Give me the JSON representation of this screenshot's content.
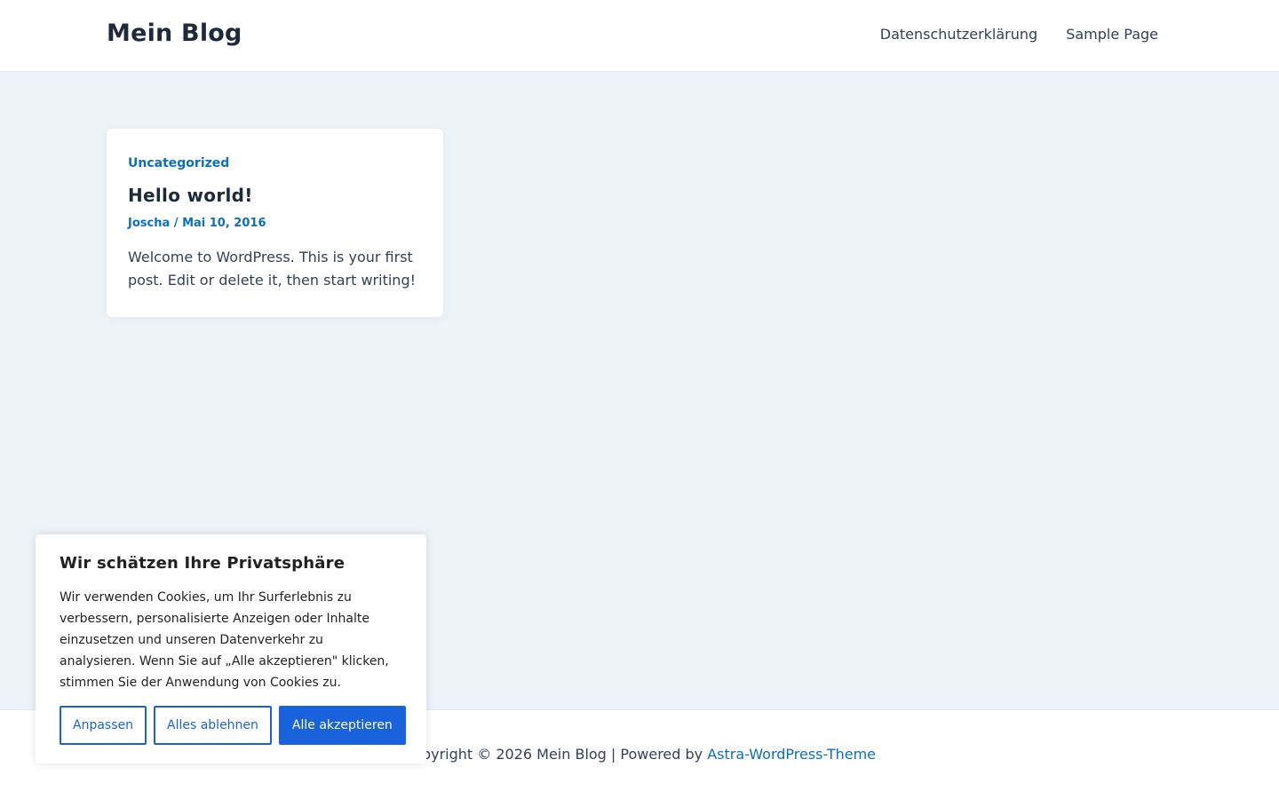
{
  "header": {
    "site_title": "Mein Blog",
    "nav": [
      {
        "label": "Datenschutzerklärung"
      },
      {
        "label": "Sample Page"
      }
    ]
  },
  "post": {
    "category": "Uncategorized",
    "title": "Hello world!",
    "author": "Joscha",
    "separator": " / ",
    "date": "Mai 10, 2016",
    "excerpt": "Welcome to WordPress. This is your first post. Edit or delete it, then start writing!"
  },
  "footer": {
    "text": "Copyright © 2026 Mein Blog | Powered by ",
    "link": "Astra-WordPress-Theme"
  },
  "cookie_banner": {
    "title": "Wir schätzen Ihre Privatsphäre",
    "text": "Wir verwenden Cookies, um Ihr Surferlebnis zu verbessern, personalisierte Anzeigen oder Inhalte einzusetzen und unseren Datenverkehr zu analysieren. Wenn Sie auf „Alle akzeptieren\" klicken, stimmen Sie der Anwendung von Cookies zu.",
    "buttons": {
      "customize": "Anpassen",
      "reject": "Alles ablehnen",
      "accept": "Alle akzeptieren"
    }
  },
  "colors": {
    "accent": "#0b6fc2",
    "cookie_button": "#1863dc",
    "page_background": "#eef3f7"
  }
}
